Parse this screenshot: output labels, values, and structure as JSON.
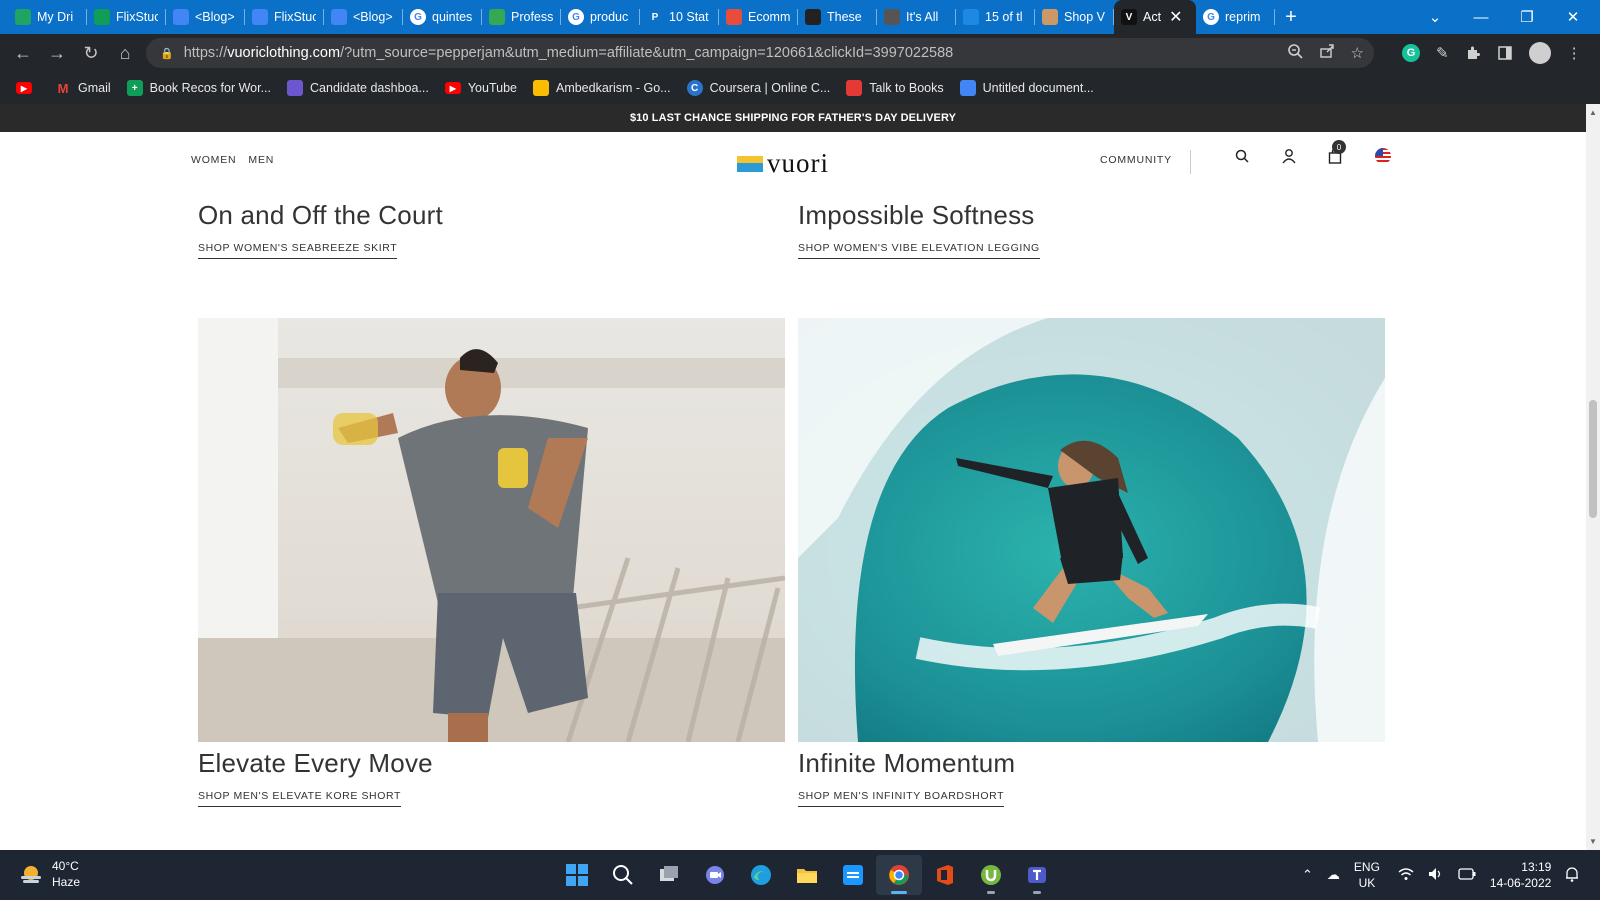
{
  "browser": {
    "tabs": [
      {
        "label": "My Dri",
        "icon": "google-drive-icon",
        "color": "#1fa463"
      },
      {
        "label": "FlixStuc",
        "icon": "google-sheets-icon",
        "color": "#0f9d58"
      },
      {
        "label": "<Blog>",
        "icon": "google-docs-icon",
        "color": "#4285f4"
      },
      {
        "label": "FlixStuc",
        "icon": "google-docs-icon",
        "color": "#4285f4"
      },
      {
        "label": "<Blog>",
        "icon": "google-docs-icon",
        "color": "#4285f4"
      },
      {
        "label": "quintes",
        "icon": "google-icon",
        "color": "#ffffff"
      },
      {
        "label": "Profess",
        "icon": "slides-icon",
        "color": "#34a853"
      },
      {
        "label": "produc",
        "icon": "google-icon",
        "color": "#ffffff"
      },
      {
        "label": "10 Stat",
        "icon": "p-icon",
        "color": "#0a70c8"
      },
      {
        "label": "Ecomm",
        "icon": "bracket-icon",
        "color": "#e84c3d"
      },
      {
        "label": "These",
        "icon": "camera-icon",
        "color": "#222222"
      },
      {
        "label": "It's All",
        "icon": "book-icon",
        "color": "#555555"
      },
      {
        "label": "15 of tl",
        "icon": "cloud-icon",
        "color": "#1e88e5"
      },
      {
        "label": "Shop V",
        "icon": "sun-icon",
        "color": "#cc9966"
      },
      {
        "label": "Act",
        "icon": "vuori-icon",
        "color": "#111111",
        "active": true
      },
      {
        "label": "reprim",
        "icon": "google-icon",
        "color": "#ffffff"
      }
    ],
    "url_host": "vuoriclothing.com",
    "url_prefix": "https://",
    "url_path": "/?utm_source=pepperjam&utm_medium=affiliate&utm_campaign=120661&clickId=3997022588",
    "bookmarks": [
      {
        "label": "",
        "icon": "youtube-icon",
        "color": "#ff0000"
      },
      {
        "label": "Gmail",
        "icon": "gmail-icon",
        "color": "#ea4335"
      },
      {
        "label": "Book Recos for Wor...",
        "icon": "sheets-icon",
        "color": "#0f9d58"
      },
      {
        "label": "Candidate dashboa...",
        "icon": "candidate-icon",
        "color": "#6e56cf"
      },
      {
        "label": "YouTube",
        "icon": "youtube-icon",
        "color": "#ff0000"
      },
      {
        "label": "Ambedkarism - Go...",
        "icon": "drive-icon",
        "color": "#fbbc04"
      },
      {
        "label": "Coursera | Online C...",
        "icon": "coursera-icon",
        "color": "#2a73cc"
      },
      {
        "label": "Talk to Books",
        "icon": "talk-icon",
        "color": "#e53935"
      },
      {
        "label": "Untitled document...",
        "icon": "docs-icon",
        "color": "#4285f4"
      }
    ]
  },
  "site": {
    "promo": "$10 LAST CHANCE SHIPPING FOR FATHER'S DAY DELIVERY",
    "nav_left": [
      "WOMEN",
      "MEN"
    ],
    "logo": "vuori",
    "nav_right": "COMMUNITY",
    "cart_count": "0",
    "cards": [
      {
        "title": "On and Off the Court",
        "link": "SHOP WOMEN'S SEABREEZE SKIRT"
      },
      {
        "title": "Impossible Softness",
        "link": "SHOP WOMEN'S VIBE ELEVATION LEGGING"
      },
      {
        "title": "Elevate Every Move",
        "link": "SHOP MEN'S ELEVATE KORE SHORT"
      },
      {
        "title": "Infinite Momentum",
        "link": "SHOP MEN'S INFINITY BOARDSHORT"
      }
    ]
  },
  "taskbar": {
    "temp": "40°C",
    "condition": "Haze",
    "lang_1": "ENG",
    "lang_2": "UK",
    "time": "13:19",
    "date": "14-06-2022"
  }
}
